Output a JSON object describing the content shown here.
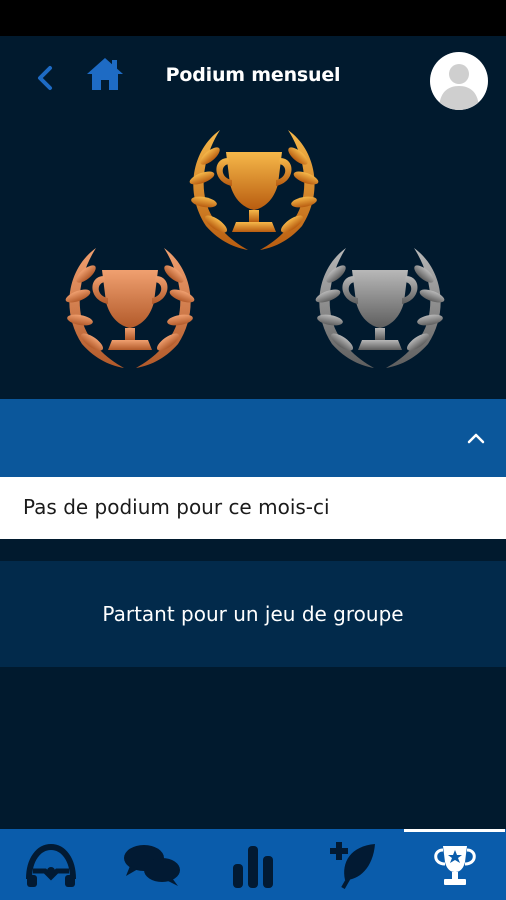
{
  "header": {
    "title": "Podium mensuel",
    "back_icon": "chevron-left-icon",
    "home_icon": "home-icon",
    "avatar_icon": "user-avatar-icon"
  },
  "podium": {
    "places": [
      {
        "rank": "gold",
        "color": "#e08a1e"
      },
      {
        "rank": "bronze",
        "color": "#c8733f"
      },
      {
        "rank": "silver",
        "color": "#8a8a8a"
      }
    ]
  },
  "accordion": {
    "collapse_icon": "chevron-up-icon",
    "empty_message": "Pas de podium pour ce mois-ci"
  },
  "group_game": {
    "label": "Partant pour un jeu de groupe"
  },
  "bottom_nav": {
    "items": [
      {
        "icon": "steering-wheel-icon",
        "active": false
      },
      {
        "icon": "chat-bubbles-icon",
        "active": false
      },
      {
        "icon": "bar-chart-icon",
        "active": false
      },
      {
        "icon": "leaf-plus-icon",
        "active": false
      },
      {
        "icon": "trophy-star-icon",
        "active": true
      }
    ]
  },
  "colors": {
    "background": "#011a2e",
    "accent_blue": "#0b579b",
    "nav_blue": "#0a5cab",
    "icon_blue": "#1e6bc4"
  }
}
